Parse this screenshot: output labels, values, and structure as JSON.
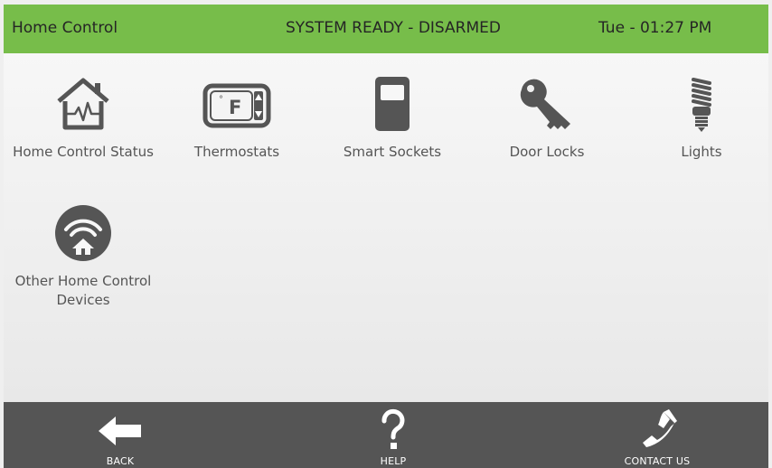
{
  "header": {
    "title": "Home Control",
    "status": "SYSTEM READY - DISARMED",
    "clock": "Tue - 01:27 PM"
  },
  "tiles": [
    {
      "label": "Home Control Status",
      "icon": "home-status-icon"
    },
    {
      "label": "Thermostats",
      "icon": "thermostat-icon"
    },
    {
      "label": "Smart Sockets",
      "icon": "smart-socket-icon"
    },
    {
      "label": "Door Locks",
      "icon": "key-icon"
    },
    {
      "label": "Lights",
      "icon": "light-bulb-icon"
    },
    {
      "label_line1": "Other Home Control",
      "label_line2": "Devices",
      "icon": "wifi-home-icon"
    }
  ],
  "footer": {
    "back": "BACK",
    "help": "HELP",
    "contact": "CONTACT US"
  },
  "colors": {
    "header_green": "#77bd4a",
    "footer_gray": "#555555",
    "icon_gray": "#4a4a4a"
  }
}
